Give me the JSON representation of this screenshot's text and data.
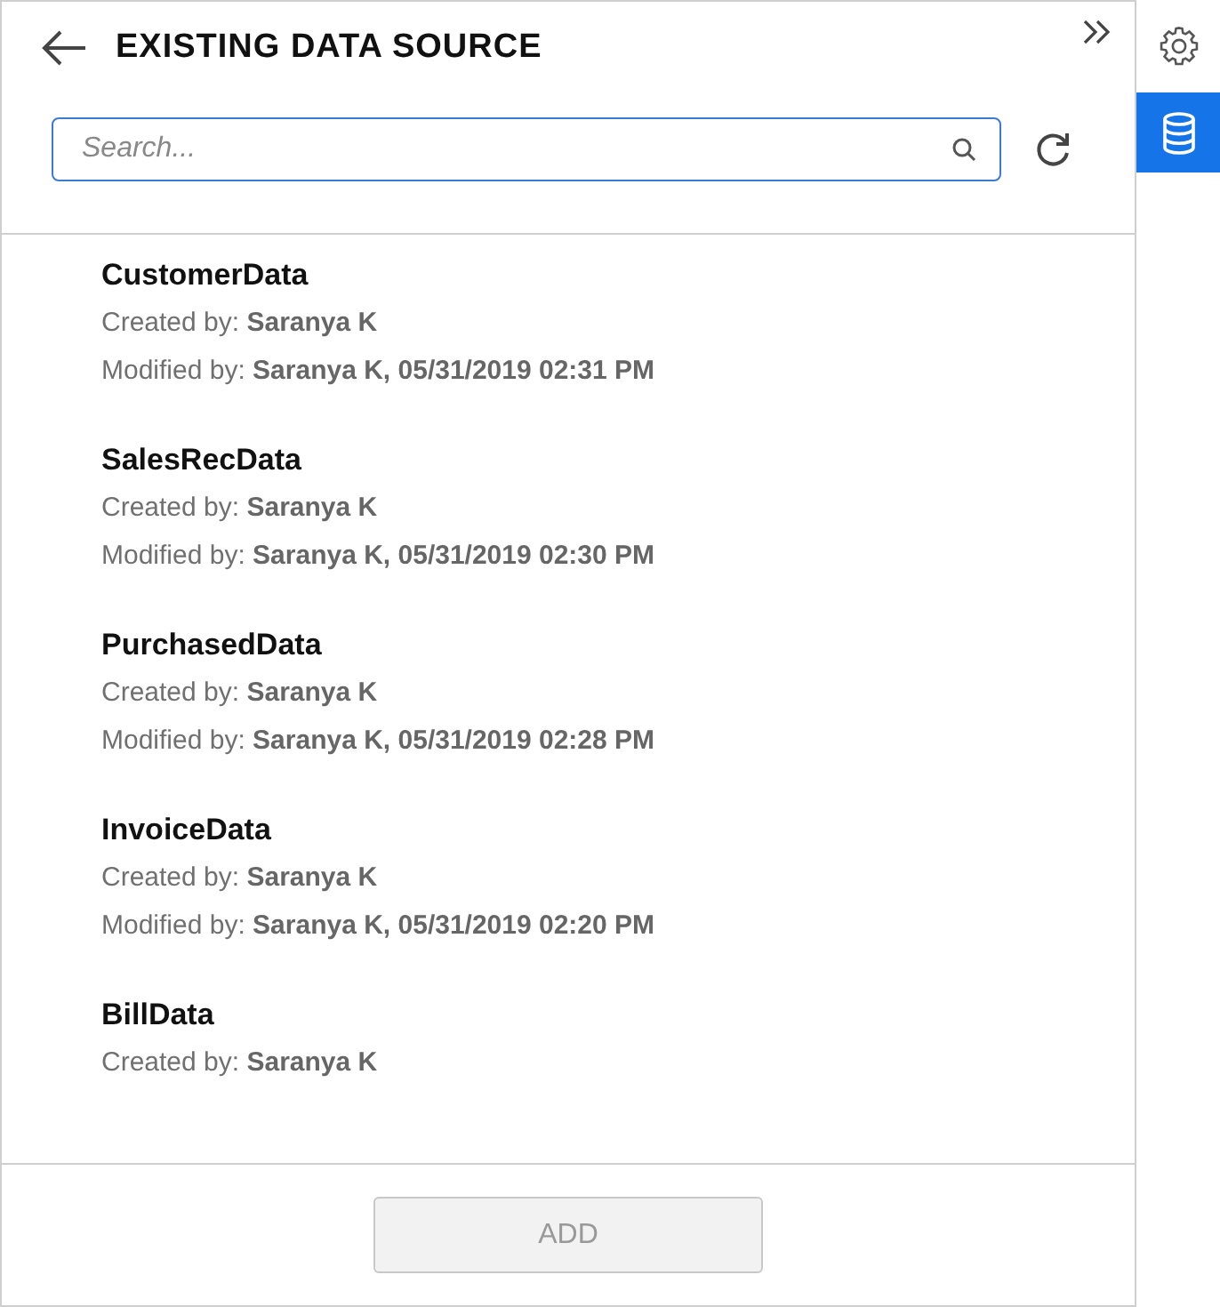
{
  "panel": {
    "title": "EXISTING DATA SOURCE",
    "search": {
      "placeholder": "Search..."
    }
  },
  "data_sources": [
    {
      "name": "CustomerData",
      "created_label": "Created by:",
      "created_by": "Saranya K",
      "modified_label": "Modified by:",
      "modified_by": "Saranya K, 05/31/2019 02:31 PM"
    },
    {
      "name": "SalesRecData",
      "created_label": "Created by:",
      "created_by": "Saranya K",
      "modified_label": "Modified by:",
      "modified_by": "Saranya K, 05/31/2019 02:30 PM"
    },
    {
      "name": "PurchasedData",
      "created_label": "Created by:",
      "created_by": "Saranya K",
      "modified_label": "Modified by:",
      "modified_by": "Saranya K, 05/31/2019 02:28 PM"
    },
    {
      "name": "InvoiceData",
      "created_label": "Created by:",
      "created_by": "Saranya K",
      "modified_label": "Modified by:",
      "modified_by": "Saranya K, 05/31/2019 02:20 PM"
    },
    {
      "name": "BillData",
      "created_label": "Created by:",
      "created_by": "Saranya K"
    }
  ],
  "add_button": {
    "label": "ADD",
    "disabled": true
  },
  "side_tabs": [
    {
      "kind": "settings",
      "selected": false
    },
    {
      "kind": "database",
      "selected": true
    }
  ]
}
